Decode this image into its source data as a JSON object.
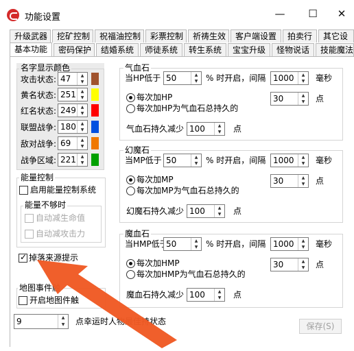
{
  "window": {
    "title": "功能设置",
    "min_glyph": "—",
    "max_glyph": "☐",
    "close_glyph": "✕"
  },
  "tabs_row1": [
    "升级武器",
    "挖矿控制",
    "祝福油控制",
    "彩票控制",
    "祈祷生效",
    "客户端设置",
    "拍卖行",
    "其它设"
  ],
  "tabs_row2": [
    "基本功能",
    "密码保护",
    "结婚系统",
    "师徒系统",
    "转生系统",
    "宝宝升级",
    "怪物说话",
    "技能魔法"
  ],
  "name_color": {
    "title": "名字显示颜色",
    "rows": [
      {
        "label": "攻击状态:",
        "value": "47",
        "color": "#a0522d"
      },
      {
        "label": "黄名状态:",
        "value": "251",
        "color": "#ffff00"
      },
      {
        "label": "红名状态:",
        "value": "249",
        "color": "#ff0000"
      },
      {
        "label": "联盟战争:",
        "value": "180",
        "color": "#0050e0"
      },
      {
        "label": "敌对战争:",
        "value": "69",
        "color": "#f07800"
      },
      {
        "label": "战争区域:",
        "value": "221",
        "color": "#00a000"
      }
    ]
  },
  "energy": {
    "title": "能量控制",
    "enable_label": "启用能量控制系统",
    "shortage_title": "能量不够时",
    "auto_hp_label": "自动减生命值",
    "auto_atk_label": "自动减攻击力"
  },
  "drop_source_label": "掉落来源提示",
  "map_event": {
    "title": "地图事件触",
    "open_label": "开启地图件触"
  },
  "bottom": {
    "value": "9",
    "desc": "点幸运时人物最佳持状态",
    "save_label": "保存(S)"
  },
  "potions": [
    {
      "title": "气血石",
      "low_label": "当HP低于",
      "low_value": "50",
      "percent_label": "% 时开启，间隔",
      "interval_value": "1000",
      "ms_label": "毫秒",
      "radio1_label": "每次加HP",
      "radio2_label": "每次加HP为气血石总持久的",
      "amount_value": "30",
      "point_label": "点",
      "reduce_label": "气血石持久减少",
      "reduce_value": "100",
      "reduce_point_label": "点"
    },
    {
      "title": "幻魔石",
      "low_label": "当MP低于",
      "low_value": "50",
      "percent_label": "% 时开启，间隔",
      "interval_value": "1000",
      "ms_label": "毫秒",
      "radio1_label": "每次加MP",
      "radio2_label": "每次加MP为气血石总持久的",
      "amount_value": "30",
      "point_label": "点",
      "reduce_label": "幻魔石持久减少",
      "reduce_value": "100",
      "reduce_point_label": "点"
    },
    {
      "title": "魔血石",
      "low_label": "当HMP低于",
      "low_value": "50",
      "percent_label": "% 时开启，间隔",
      "interval_value": "1000",
      "ms_label": "毫秒",
      "radio1_label": "每次加HMP",
      "radio2_label": "每次加HMP为气血石总持久的",
      "amount_value": "30",
      "point_label": "点",
      "reduce_label": "魔血石持久减少",
      "reduce_value": "100",
      "reduce_point_label": "点"
    }
  ],
  "colors": {
    "annotation_arrow": "#f05a24"
  }
}
